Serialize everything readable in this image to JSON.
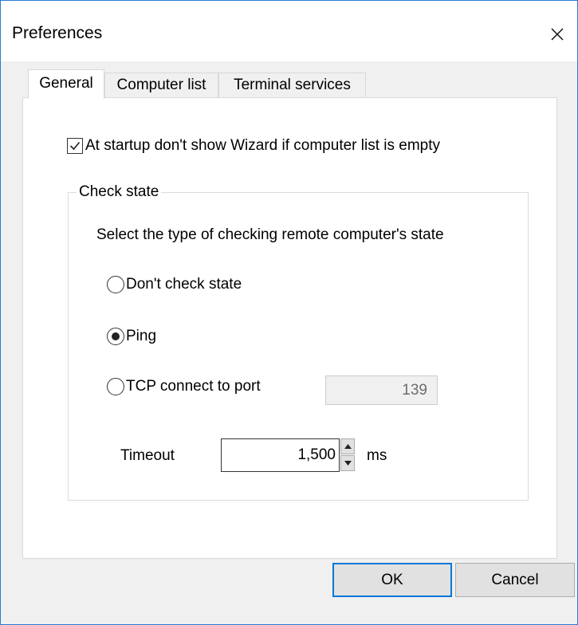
{
  "window": {
    "title": "Preferences",
    "accent_color": "#0078d7"
  },
  "tabs": [
    {
      "label": "General",
      "active": true
    },
    {
      "label": "Computer list",
      "active": false
    },
    {
      "label": "Terminal services",
      "active": false
    }
  ],
  "general": {
    "wizard_checkbox": {
      "label": "At startup don't show Wizard if computer list is empty",
      "checked": true
    },
    "check_state": {
      "legend": "Check state",
      "description": "Select the type  of  checking remote computer's state",
      "options": [
        {
          "label": "Don't check state",
          "selected": false
        },
        {
          "label": "Ping",
          "selected": true
        },
        {
          "label": "TCP connect to port",
          "selected": false
        }
      ],
      "port_value": "139",
      "port_enabled": false,
      "timeout_label": "Timeout",
      "timeout_value": "1,500",
      "timeout_unit": "ms"
    }
  },
  "buttons": {
    "ok_label": "OK",
    "cancel_label": "Cancel"
  },
  "icons": {
    "close": "close-icon",
    "checkmark": "checkmark-icon",
    "spin_up": "arrow-up-icon",
    "spin_down": "arrow-down-icon"
  }
}
